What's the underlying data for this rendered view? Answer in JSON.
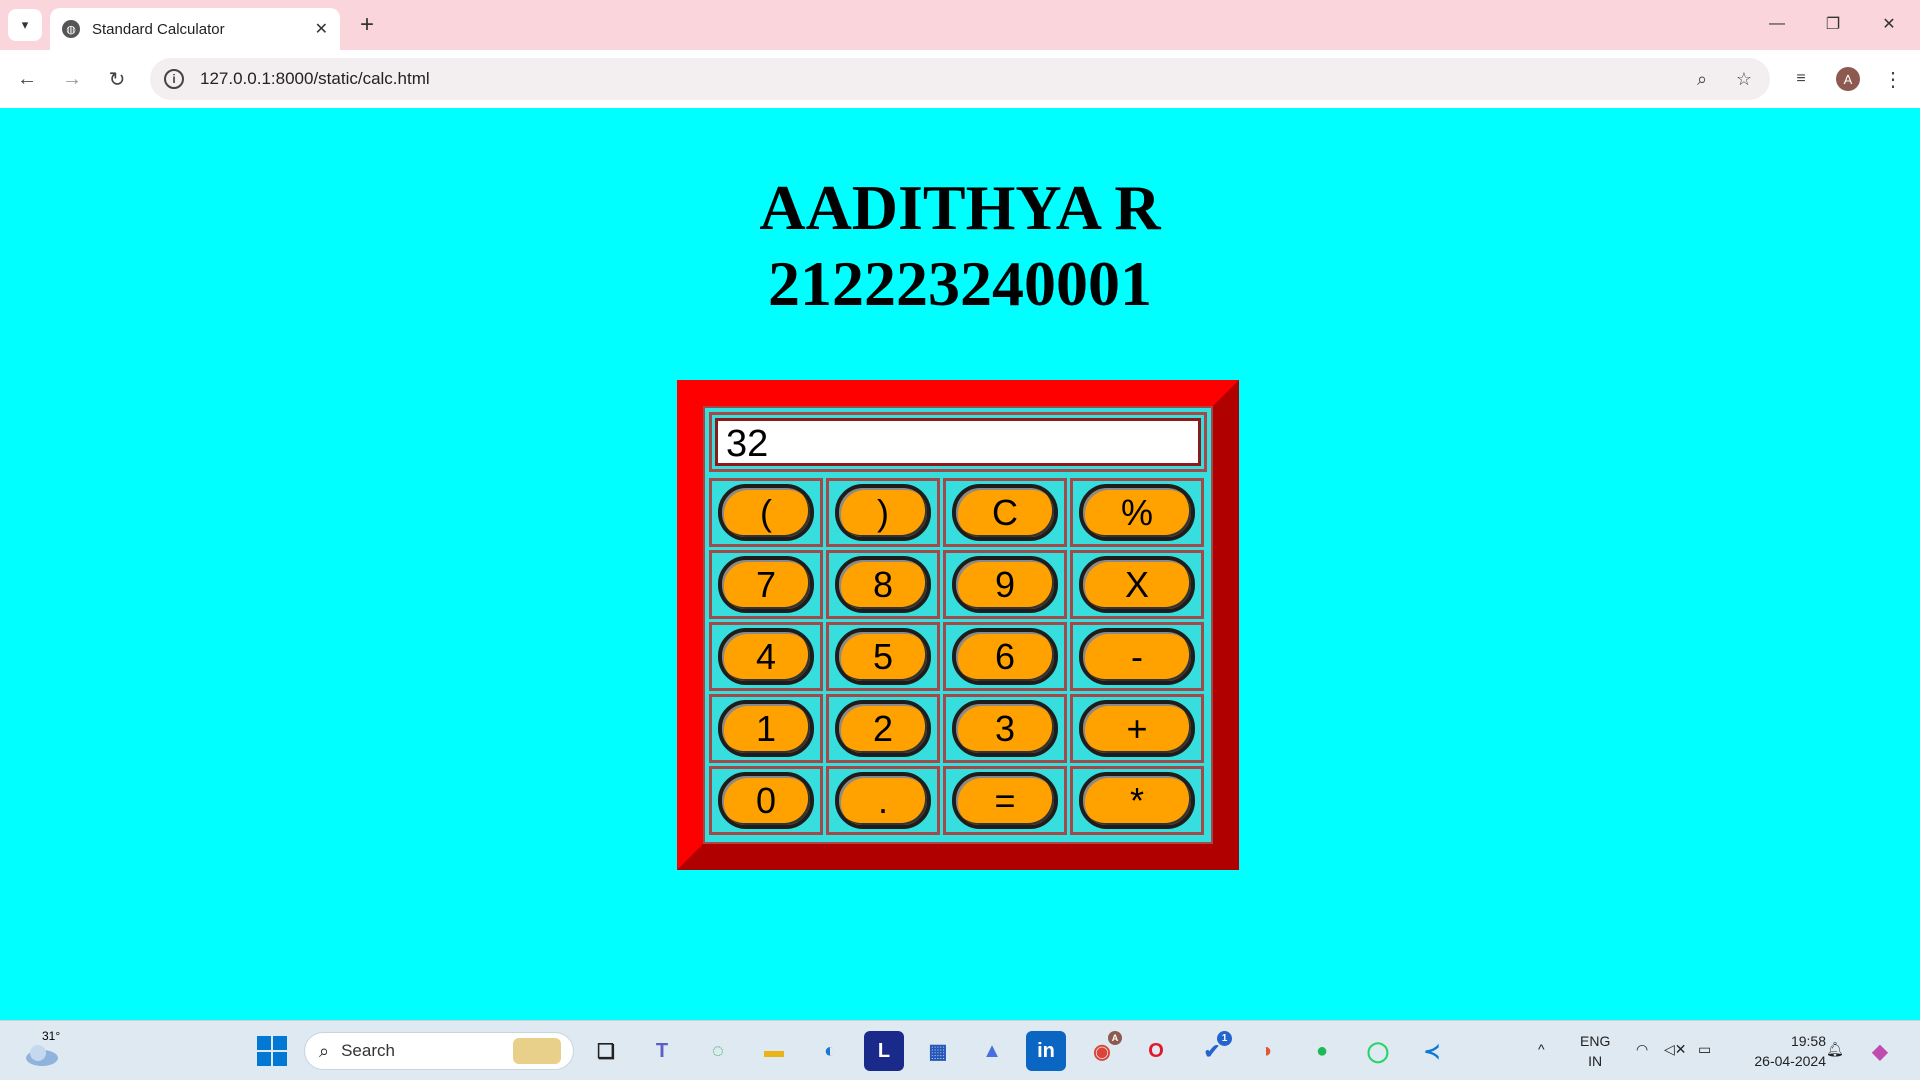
{
  "browser": {
    "tab_title": "Standard Calculator",
    "url": "127.0.0.1:8000/static/calc.html",
    "profile_initial": "A"
  },
  "page": {
    "name": "AADITHYA R",
    "id": "212223240001"
  },
  "calculator": {
    "display_value": "32",
    "rows": [
      [
        "(",
        ")",
        "C",
        "%"
      ],
      [
        "7",
        "8",
        "9",
        "X"
      ],
      [
        "4",
        "5",
        "6",
        "-"
      ],
      [
        "1",
        "2",
        "3",
        "+"
      ],
      [
        "0",
        ".",
        "=",
        "*"
      ]
    ]
  },
  "taskbar": {
    "temperature": "31°",
    "search_placeholder": "Search",
    "language": "ENG",
    "region": "IN",
    "time": "19:58",
    "date": "26-04-2024",
    "todo_badge": "1",
    "chrome_badge": "A"
  },
  "colors": {
    "page_bg": "#00ffff",
    "frame_light": "#ff0000",
    "frame_dark": "#b00000",
    "key_fill": "#ffa200"
  }
}
